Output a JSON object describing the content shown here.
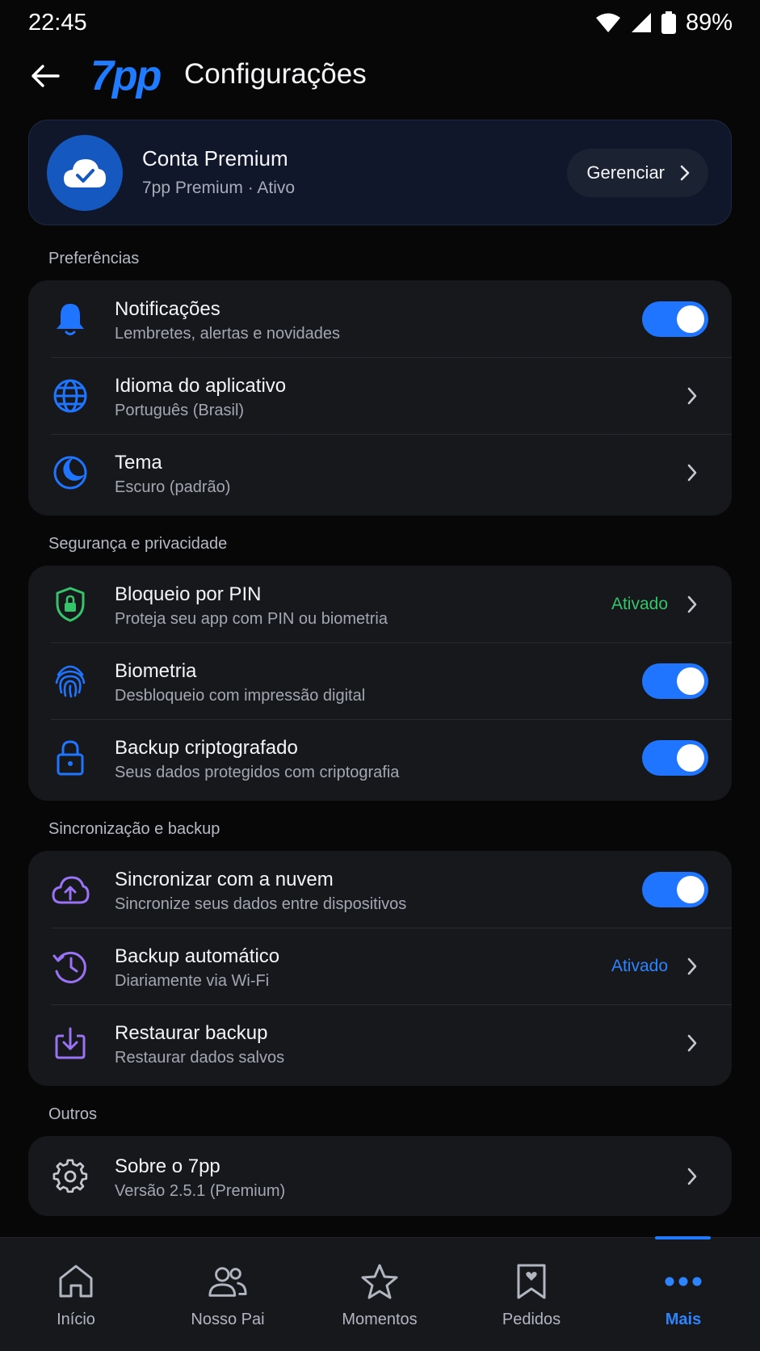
{
  "status_bar": {
    "time": "22:45",
    "battery": "89%",
    "icons": [
      "wifi-icon",
      "signal-icon",
      "battery-icon"
    ]
  },
  "header": {
    "logo": "7pp",
    "title": "Configurações"
  },
  "premium": {
    "title": "Conta Premium",
    "subtitle": "7pp Premium · Ativo",
    "manage_label": "Gerenciar",
    "icon": "cloud-check-icon"
  },
  "sections": [
    {
      "label": "Preferências",
      "rows": [
        {
          "title": "Notificações",
          "subtitle": "Lembretes, alertas e novidades",
          "icon": "bell-icon"
        },
        {
          "title": "Idioma do aplicativo",
          "subtitle": "Português (Brasil)",
          "icon": "globe-icon"
        },
        {
          "title": "Tema",
          "subtitle": "Escuro (padrão)",
          "icon": "moon-icon"
        }
      ]
    },
    {
      "label": "Segurança e privacidade",
      "rows": [
        {
          "title": "Bloqueio por PIN",
          "subtitle": "Proteja seu app com PIN ou biometria",
          "value": "Ativado",
          "icon": "shield-lock-icon"
        },
        {
          "title": "Biometria",
          "subtitle": "Desbloqueio com impressão digital",
          "icon": "fingerprint-icon"
        },
        {
          "title": "Backup criptografado",
          "subtitle": "Seus dados protegidos com criptografia",
          "icon": "lock-icon"
        }
      ]
    },
    {
      "label": "Sincronização e backup",
      "rows": [
        {
          "title": "Sincronizar com a nuvem",
          "subtitle": "Sincronize seus dados entre dispositivos",
          "icon": "cloud-upload-icon"
        },
        {
          "title": "Backup automático",
          "subtitle": "Diariamente via Wi-Fi",
          "value": "Ativado",
          "icon": "history-icon"
        },
        {
          "title": "Restaurar backup",
          "subtitle": "Restaurar dados salvos",
          "icon": "download-icon"
        }
      ]
    },
    {
      "label": "Outros",
      "rows": [
        {
          "title": "Sobre o 7pp",
          "subtitle": "Versão 2.5.1 (Premium)",
          "icon": "gear-icon"
        }
      ]
    }
  ],
  "toggles_on": {
    "notifications": true,
    "biometrics": true,
    "encrypted_backup": true,
    "cloud_sync": true
  },
  "bottom_nav": [
    {
      "label": "Início",
      "icon": "home-icon"
    },
    {
      "label": "Nosso Pai",
      "icon": "people-icon"
    },
    {
      "label": "Momentos",
      "icon": "star-icon"
    },
    {
      "label": "Pedidos",
      "icon": "bookmark-heart-icon"
    },
    {
      "label": "Mais",
      "icon": "more-dots-icon",
      "active": true
    }
  ],
  "colors": {
    "background": "#070708",
    "card": "#17181c",
    "accent_blue": "#1f75ff",
    "green_status": "#35c46a",
    "purple_icon": "#9a72f5"
  }
}
